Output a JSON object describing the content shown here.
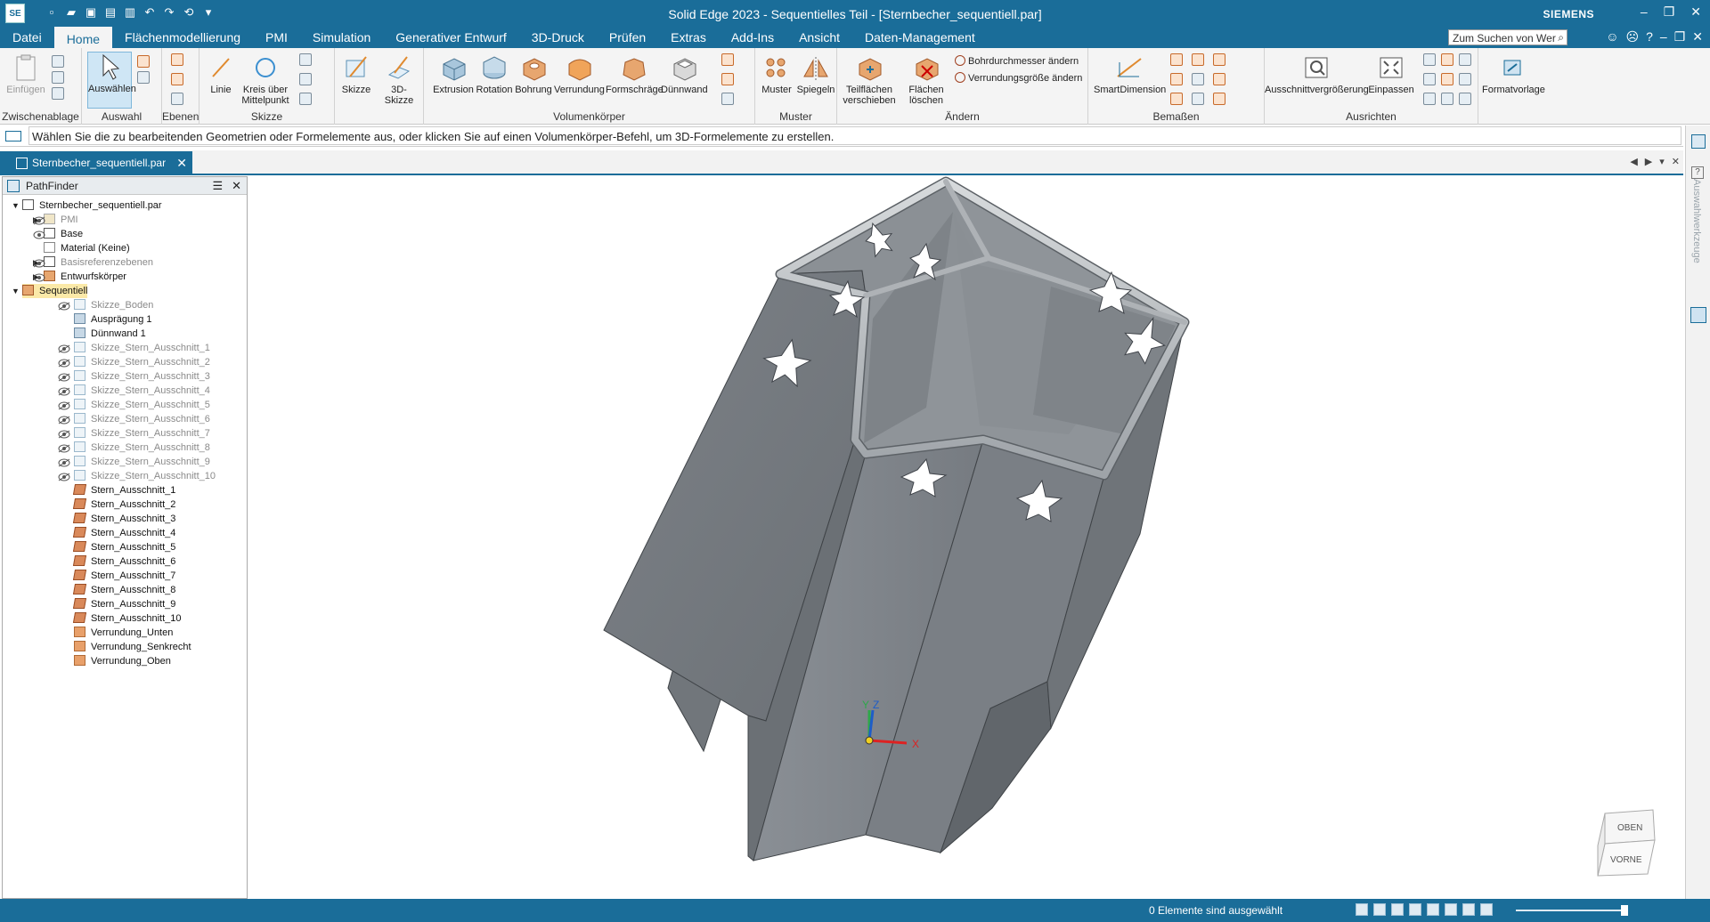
{
  "titlebar": {
    "logo": "SE",
    "title": "Solid Edge 2023 - Sequentielles Teil - [Sternbecher_sequentiell.par]",
    "brand": "SIEMENS"
  },
  "menu": {
    "tabs": [
      "Datei",
      "Home",
      "Flächenmodellierung",
      "PMI",
      "Simulation",
      "Generativer Entwurf",
      "3D-Druck",
      "Prüfen",
      "Extras",
      "Add-Ins",
      "Ansicht",
      "Daten-Management"
    ],
    "active_tab": "Home",
    "search_placeholder": "Zum Suchen von Wer"
  },
  "ribbon": {
    "groups": {
      "clipboard": "Zwischenablage",
      "select": "Auswahl",
      "planes": "Ebenen",
      "sketch": "Skizze",
      "solids": "Volumenkörper",
      "pattern": "Muster",
      "modify": "Ändern",
      "dimension": "Bemaßen",
      "orient": "Ausrichten"
    },
    "buttons": {
      "paste": "Einfügen",
      "select": "Auswählen",
      "line": "Linie",
      "circle": "Kreis über Mittelpunkt",
      "sketch": "Skizze",
      "sketch3d": "3D-Skizze",
      "extrude": "Extrusion",
      "revolve": "Rotation",
      "hole": "Bohrung",
      "round": "Verrundung",
      "draft": "Formschräge",
      "thinwall": "Dünnwand",
      "pattern": "Muster",
      "mirror": "Spiegeln",
      "move_faces": "Teilflächen verschieben",
      "delete_faces": "Flächen löschen",
      "change_hole_dia": "Bohrdurchmesser ändern",
      "change_round_size": "Verrundungsgröße ändern",
      "smart_dimension": "SmartDimension",
      "zoom_area": "Ausschnittvergrößerung",
      "fit": "Einpassen",
      "style": "Formatvorlage"
    }
  },
  "prompt": "Wählen Sie die zu bearbeitenden Geometrien oder Formelemente aus, oder klicken Sie auf einen Volumenkörper-Befehl, um 3D-Formelemente zu erstellen.",
  "document_tab": "Sternbecher_sequentiell.par",
  "pathfinder": {
    "title": "PathFinder",
    "root": "Sternbecher_sequentiell.par",
    "top_items": [
      "PMI",
      "Base",
      "Material (Keine)",
      "Basisreferenzebenen",
      "Entwurfskörper",
      "Sequentiell"
    ],
    "features": [
      "Skizze_Boden",
      "Ausprägung 1",
      "Dünnwand 1",
      "Skizze_Stern_Ausschnitt_1",
      "Skizze_Stern_Ausschnitt_2",
      "Skizze_Stern_Ausschnitt_3",
      "Skizze_Stern_Ausschnitt_4",
      "Skizze_Stern_Ausschnitt_5",
      "Skizze_Stern_Ausschnitt_6",
      "Skizze_Stern_Ausschnitt_7",
      "Skizze_Stern_Ausschnitt_8",
      "Skizze_Stern_Ausschnitt_9",
      "Skizze_Stern_Ausschnitt_10",
      "Stern_Ausschnitt_1",
      "Stern_Ausschnitt_2",
      "Stern_Ausschnitt_3",
      "Stern_Ausschnitt_4",
      "Stern_Ausschnitt_5",
      "Stern_Ausschnitt_6",
      "Stern_Ausschnitt_7",
      "Stern_Ausschnitt_8",
      "Stern_Ausschnitt_9",
      "Stern_Ausschnitt_10",
      "Verrundung_Unten",
      "Verrundung_Senkrecht",
      "Verrundung_Oben"
    ]
  },
  "viewcube": {
    "top": "OBEN",
    "front": "VORNE"
  },
  "triad": {
    "x": "X",
    "y": "Y",
    "z": "Z"
  },
  "right_strip_label": "Auswahlwerkzeuge",
  "status": "0 Elemente sind ausgewählt",
  "colors": {
    "accent": "#1a6d99",
    "model": "#757a80",
    "model_light": "#9aa0a6"
  }
}
